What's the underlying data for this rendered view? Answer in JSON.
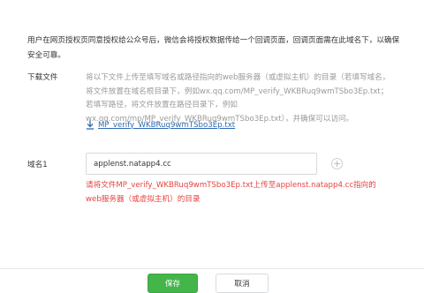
{
  "intro": "用户在网页授权页同意授权给公众号后，微信会将授权数据传给一个回调页面，回调页面需在此域名下，以确保安全可靠。",
  "download": {
    "label": "下载文件",
    "description": "将以下文件上传至填写域名或路径指向的web服务器（或虚拟主机）的目录（若填写域名，将文件放置在域名根目录下，例如wx.qq.com/MP_verify_WKBRuq9wmTSbo3Ep.txt；若填写路径，将文件放置在路径目录下，例如wx.qq.com/mp/MP_verify_WKBRuq9wmTSbo3Ep.txt），并确保可以访问。",
    "file_link": "MP_verify_WKBRuq9wmTSbo3Ep.txt",
    "icon": "download-icon"
  },
  "domain": {
    "label": "域名1",
    "value": "applenst.natapp4.cc",
    "add_icon": "plus-circle-icon",
    "error": "请将文件MP_verify_WKBRuq9wmTSbo3Ep.txt上传至applenst.natapp4.cc指向的web服务器（或虚拟主机）的目录"
  },
  "buttons": {
    "save": "保存",
    "cancel": "取消"
  },
  "colors": {
    "link": "#2e69b3",
    "error": "#e64340",
    "primary": "#44b549",
    "muted": "#9a9a9a"
  }
}
